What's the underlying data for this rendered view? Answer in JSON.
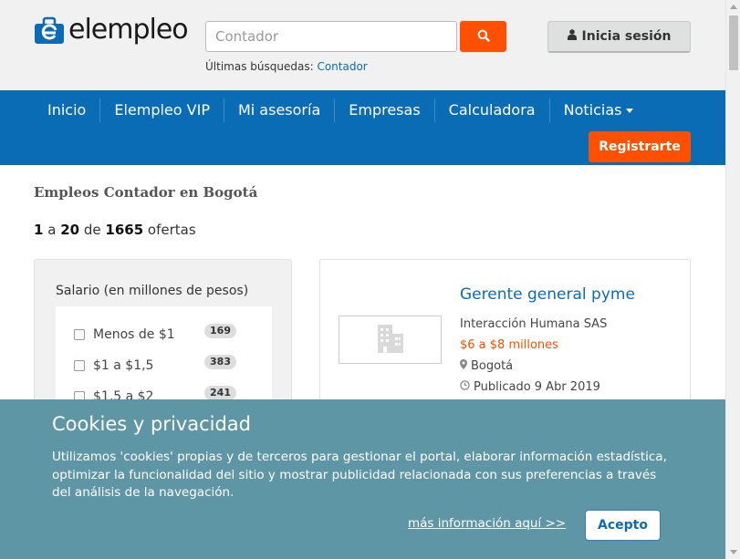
{
  "header": {
    "logo_text": "elempleo",
    "search_placeholder": "Contador",
    "recent_label": "Últimas búsquedas:",
    "recent_link": "Contador",
    "login_label": "Inicia sesión"
  },
  "nav": {
    "items": [
      {
        "label": "Inicio"
      },
      {
        "label": "Elempleo VIP"
      },
      {
        "label": "Mi asesoría"
      },
      {
        "label": "Empresas"
      },
      {
        "label": "Calculadora"
      },
      {
        "label": "Noticias"
      }
    ],
    "register_label": "Registrarte"
  },
  "main": {
    "page_title": "Empleos Contador en Bogotá",
    "results": {
      "from": "1",
      "a": "a",
      "to": "20",
      "de": "de",
      "total": "1665",
      "suffix": "ofertas"
    }
  },
  "filters": {
    "title": "Salario (en millones de pesos)",
    "options": [
      {
        "label": "Menos de $1",
        "count": "169"
      },
      {
        "label": "$1 a $1,5",
        "count": "383"
      },
      {
        "label": "$1,5 a $2",
        "count": "241"
      }
    ]
  },
  "job": {
    "title": "Gerente general pyme",
    "company": "Interacción Humana SAS",
    "salary": "$6 a $8 millones",
    "location": "Bogotá",
    "published": "Publicado 9 Abr 2019"
  },
  "cookie": {
    "title": "Cookies y privacidad",
    "text": "Utilizamos 'cookies' propias y de terceros para gestionar el portal, elaborar información estadística, optimizar la funcionalidad del sitio y mostrar publicidad relacionada con sus preferencias a través del análisis de la navegación.",
    "more_link": "más información aquí >>",
    "accept_label": "Acepto"
  },
  "colors": {
    "brand_blue": "#0a6cb5",
    "accent_orange": "#fe5000",
    "cookie_bg": "#5f96a5"
  },
  "icons": [
    "elempleo-logo-icon",
    "search-icon",
    "user-icon",
    "building-icon",
    "map-marker-icon",
    "clock-icon",
    "caret-down-icon"
  ]
}
